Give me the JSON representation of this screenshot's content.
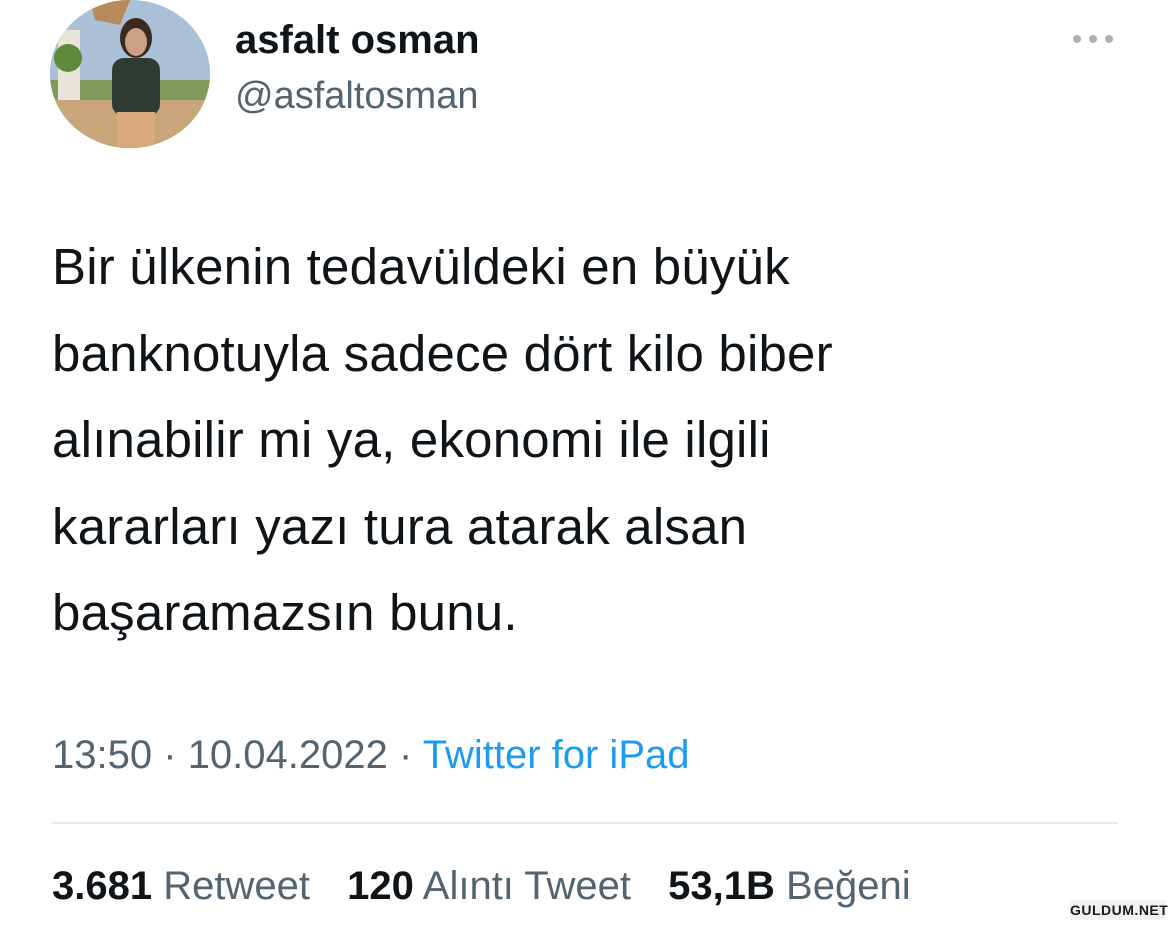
{
  "author": {
    "display_name": "asfalt osman",
    "handle": "@asfaltosman",
    "avatar_icon": "profile-photo"
  },
  "menu": {
    "icon": "more-horizontal-icon"
  },
  "tweet": {
    "text": "Bir ülkenin tedavüldeki en büyük\nbanknotuyla sadece dört kilo biber\nalınabilir mi ya, ekonomi ile ilgili\nkararları yazı tura atarak alsan\nbaşaramazsın bunu.",
    "time": "13:50",
    "separator": "·",
    "date": "10.04.2022",
    "source": "Twitter for iPad"
  },
  "stats": {
    "retweets": {
      "count": "3.681",
      "label": "Retweet"
    },
    "quotes": {
      "count": "120",
      "label": "Alıntı Tweet"
    },
    "likes": {
      "count": "53,1B",
      "label": "Beğeni"
    }
  },
  "watermark": {
    "text": "GULDUM.NET"
  },
  "colors": {
    "text": "#0f1419",
    "secondary": "#536471",
    "link": "#1d9bf0",
    "divider": "#e6e8ea",
    "background": "#ffffff"
  }
}
